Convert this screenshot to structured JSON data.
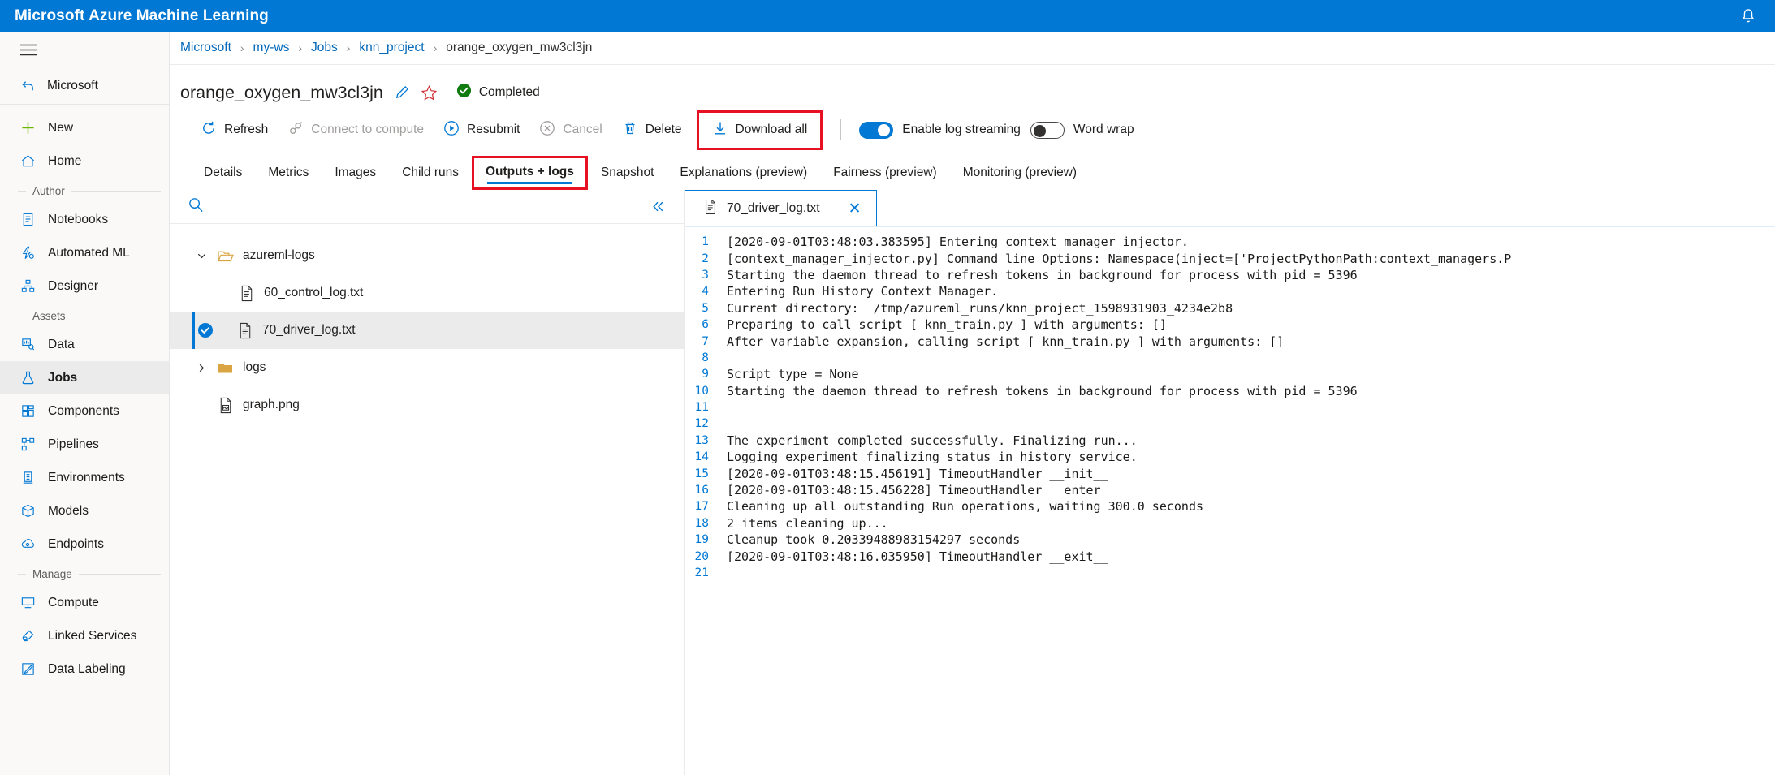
{
  "topbar": {
    "title": "Microsoft Azure Machine Learning",
    "bell_icon": "bell-icon"
  },
  "sidebar": {
    "hamburger_icon": "hamburger-icon",
    "back_label": "Microsoft",
    "items": [
      {
        "label": "New",
        "icon": "plus-icon"
      },
      {
        "label": "Home",
        "icon": "home-icon"
      }
    ],
    "group_author": "Author",
    "author_items": [
      {
        "label": "Notebooks",
        "icon": "notebook-icon"
      },
      {
        "label": "Automated ML",
        "icon": "automated-ml-icon"
      },
      {
        "label": "Designer",
        "icon": "designer-icon"
      }
    ],
    "group_assets": "Assets",
    "assets_items": [
      {
        "label": "Data",
        "icon": "data-icon"
      },
      {
        "label": "Jobs",
        "icon": "jobs-icon"
      },
      {
        "label": "Components",
        "icon": "components-icon"
      },
      {
        "label": "Pipelines",
        "icon": "pipelines-icon"
      },
      {
        "label": "Environments",
        "icon": "environments-icon"
      },
      {
        "label": "Models",
        "icon": "models-icon"
      },
      {
        "label": "Endpoints",
        "icon": "endpoints-icon"
      }
    ],
    "group_manage": "Manage",
    "manage_items": [
      {
        "label": "Compute",
        "icon": "compute-icon"
      },
      {
        "label": "Linked Services",
        "icon": "linked-services-icon"
      },
      {
        "label": "Data Labeling",
        "icon": "data-labeling-icon"
      }
    ],
    "active": "Jobs"
  },
  "breadcrumb": {
    "items": [
      "Microsoft",
      "my-ws",
      "Jobs",
      "knn_project",
      "orange_oxygen_mw3cl3jn"
    ],
    "separator": "›"
  },
  "header": {
    "title": "orange_oxygen_mw3cl3jn",
    "edit_icon": "pencil-icon",
    "favorite_icon": "star-icon",
    "status_icon": "check-circle-icon",
    "status": "Completed",
    "status_color": "#107c10"
  },
  "toolbar": {
    "refresh_label": "Refresh",
    "connect_label": "Connect to compute",
    "resubmit_label": "Resubmit",
    "cancel_label": "Cancel",
    "delete_label": "Delete",
    "download_all_label": "Download all",
    "download_highlight_color": "#e81123",
    "log_streaming_label": "Enable log streaming",
    "log_streaming_on": true,
    "word_wrap_label": "Word wrap",
    "word_wrap_on": false
  },
  "tabs": {
    "items": [
      "Details",
      "Metrics",
      "Images",
      "Child runs",
      "Outputs + logs",
      "Snapshot",
      "Explanations (preview)",
      "Fairness (preview)",
      "Monitoring (preview)"
    ],
    "selected": "Outputs + logs",
    "highlight_color": "#e81123",
    "underline_color": "#0078d4"
  },
  "file_panel": {
    "search_icon": "search-icon",
    "search_placeholder": "",
    "collapse_icon": "chevron-double-left-icon",
    "tree": [
      {
        "label": "azureml-logs",
        "type": "folder",
        "expanded": true,
        "indent": 0,
        "selected": false
      },
      {
        "label": "60_control_log.txt",
        "type": "file",
        "indent": 1,
        "selected": false
      },
      {
        "label": "70_driver_log.txt",
        "type": "file",
        "indent": 1,
        "selected": true
      },
      {
        "label": "logs",
        "type": "folder",
        "expanded": false,
        "indent": 0,
        "selected": false
      },
      {
        "label": "graph.png",
        "type": "image",
        "indent": 1,
        "selected": false
      }
    ]
  },
  "log_viewer": {
    "tab_label": "70_driver_log.txt",
    "tab_icon": "file-text-icon",
    "close_icon": "close-icon",
    "lines": [
      "[2020-09-01T03:48:03.383595] Entering context manager injector.",
      "[context_manager_injector.py] Command line Options: Namespace(inject=['ProjectPythonPath:context_managers.P",
      "Starting the daemon thread to refresh tokens in background for process with pid = 5396",
      "Entering Run History Context Manager.",
      "Current directory:  /tmp/azureml_runs/knn_project_1598931903_4234e2b8",
      "Preparing to call script [ knn_train.py ] with arguments: []",
      "After variable expansion, calling script [ knn_train.py ] with arguments: []",
      "",
      "Script type = None",
      "Starting the daemon thread to refresh tokens in background for process with pid = 5396",
      "",
      "",
      "The experiment completed successfully. Finalizing run...",
      "Logging experiment finalizing status in history service.",
      "[2020-09-01T03:48:15.456191] TimeoutHandler __init__",
      "[2020-09-01T03:48:15.456228] TimeoutHandler __enter__",
      "Cleaning up all outstanding Run operations, waiting 300.0 seconds",
      "2 items cleaning up...",
      "Cleanup took 0.20339488983154297 seconds",
      "[2020-09-01T03:48:16.035950] TimeoutHandler __exit__",
      ""
    ]
  }
}
